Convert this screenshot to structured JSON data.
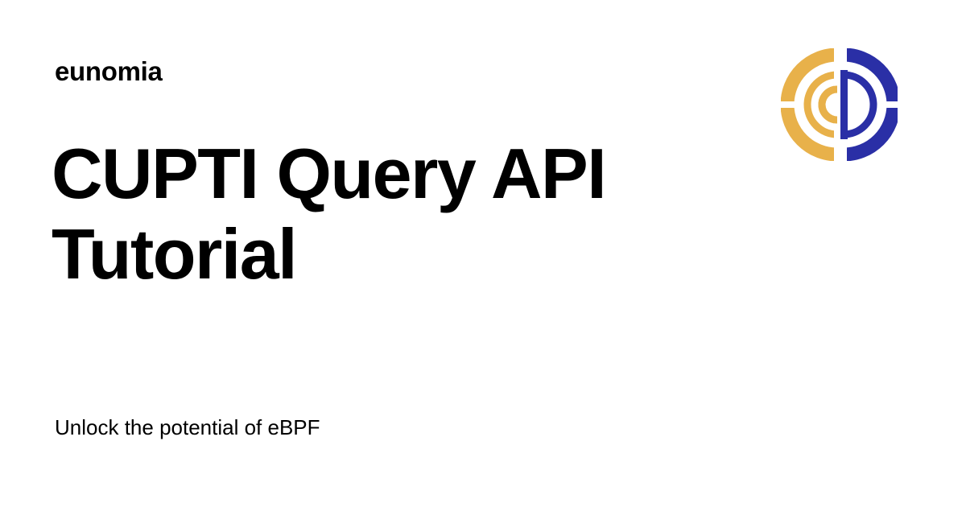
{
  "site": {
    "name": "eunomia",
    "logo_icon": "eunomia-logo-icon"
  },
  "article": {
    "title": "CUPTI Query API Tutorial",
    "tagline": "Unlock the potential of eBPF"
  },
  "colors": {
    "background": "#ffffff",
    "text": "#000000",
    "logo_gold": "#E8B14A",
    "logo_navy": "#2A2FA6"
  }
}
